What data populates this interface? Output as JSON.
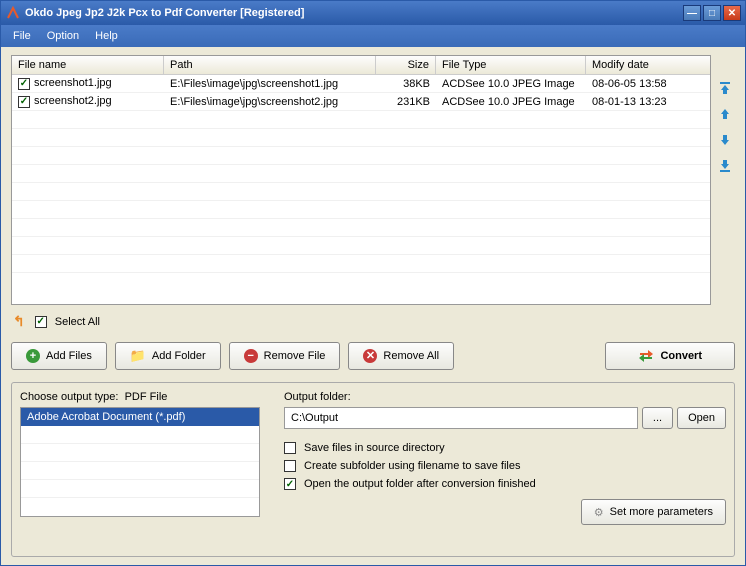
{
  "title": "Okdo Jpeg Jp2 J2k Pcx to Pdf Converter [Registered]",
  "menu": {
    "file": "File",
    "option": "Option",
    "help": "Help"
  },
  "columns": {
    "name": "File name",
    "path": "Path",
    "size": "Size",
    "type": "File Type",
    "date": "Modify date"
  },
  "rows": [
    {
      "name": "screenshot1.jpg",
      "path": "E:\\Files\\image\\jpg\\screenshot1.jpg",
      "size": "38KB",
      "type": "ACDSee 10.0 JPEG Image",
      "date": "08-06-05 13:58"
    },
    {
      "name": "screenshot2.jpg",
      "path": "E:\\Files\\image\\jpg\\screenshot2.jpg",
      "size": "231KB",
      "type": "ACDSee 10.0 JPEG Image",
      "date": "08-01-13 13:23"
    }
  ],
  "selectAll": "Select All",
  "buttons": {
    "addFiles": "Add Files",
    "addFolder": "Add Folder",
    "removeFile": "Remove File",
    "removeAll": "Remove All",
    "convert": "Convert"
  },
  "outputTypeLabel": "Choose output type:",
  "outputTypeValue": "PDF File",
  "typeList": {
    "item": "Adobe Acrobat Document (*.pdf)"
  },
  "outputFolderLabel": "Output folder:",
  "outputFolderValue": "C:\\Output",
  "browse": "...",
  "open": "Open",
  "checks": {
    "saveSource": "Save files in source directory",
    "subfolder": "Create subfolder using filename to save files",
    "openAfter": "Open the output folder after conversion finished"
  },
  "moreParams": "Set more parameters"
}
